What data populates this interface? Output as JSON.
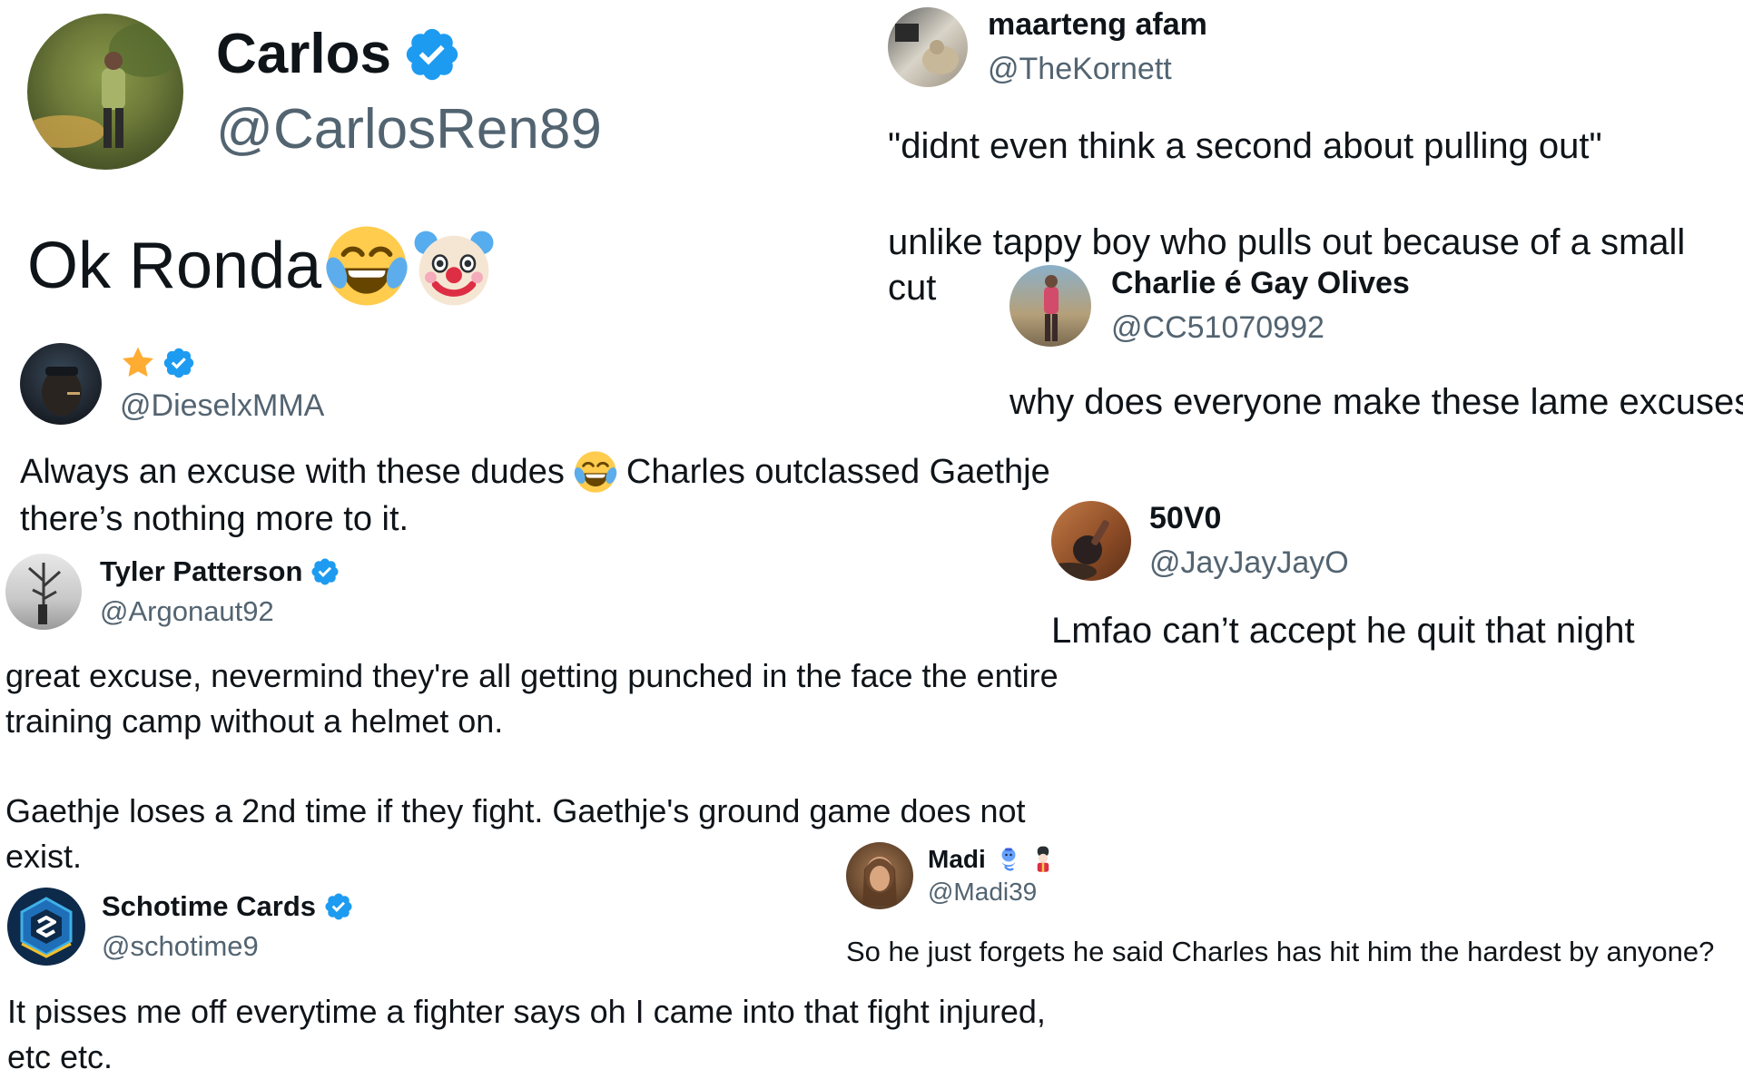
{
  "colors": {
    "verified_badge": "#1d9bf0",
    "handle_text": "#536471",
    "body_text": "#0f1419",
    "star": "#ffa800"
  },
  "tweets": [
    {
      "id": "carlos",
      "name": "Carlos",
      "handle": "@CarlosRen89",
      "verified": true,
      "text": "Ok Ronda",
      "emojis": [
        "joy-emoji",
        "clown-emoji"
      ]
    },
    {
      "id": "maarteng",
      "name": "maarteng afam",
      "handle": "@TheKornett",
      "verified": false,
      "text_line1": "\"didnt even think a second about pulling out\"",
      "text_line2": "unlike tappy boy who pulls out because of a small cut"
    },
    {
      "id": "charlie",
      "name": "Charlie é Gay Olives",
      "handle": "@CC51070992",
      "verified": false,
      "text": "why does everyone make these lame excuses"
    },
    {
      "id": "diesel",
      "name_icon": "star-icon",
      "handle": "@DieselxMMA",
      "verified": true,
      "text_part1": "Always an excuse with these dudes",
      "text_part2": "Charles outclassed Gaethje",
      "text_line2": "there’s nothing more to it.",
      "emojis": [
        "joy-emoji"
      ]
    },
    {
      "id": "50v0",
      "name": "50V0",
      "handle": "@JayJayJayO",
      "verified": false,
      "text": "Lmfao can’t accept he quit that night"
    },
    {
      "id": "tyler",
      "name": "Tyler Patterson",
      "handle": "@Argonaut92",
      "verified": true,
      "text_line1": "great excuse, nevermind they're all getting punched in the face the entire",
      "text_line2": "training camp without a helmet on.",
      "text_line3": "Gaethje loses a 2nd time if they fight. Gaethje's ground game does not",
      "text_line4": "exist."
    },
    {
      "id": "madi",
      "name": "Madi",
      "handle": "@Madi39",
      "verified": false,
      "name_emojis": [
        "genie-emoji",
        "guard-emoji"
      ],
      "text": "So he just forgets he said Charles has hit him the hardest by anyone?"
    },
    {
      "id": "schotime",
      "name": "Schotime Cards",
      "handle": "@schotime9",
      "verified": true,
      "text_line1": "It pisses me off everytime a fighter says oh I came into that fight injured,",
      "text_line2": "etc etc."
    }
  ]
}
